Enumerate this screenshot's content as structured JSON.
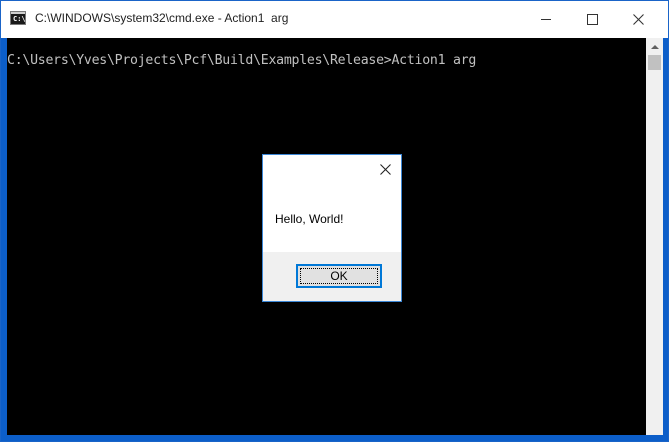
{
  "window": {
    "title": "C:\\WINDOWS\\system32\\cmd.exe - Action1  arg",
    "icon": "cmd-icon",
    "icon_text": "C:\\"
  },
  "console": {
    "prompt_line": "C:\\Users\\Yves\\Projects\\Pcf\\Build\\Examples\\Release>Action1 arg"
  },
  "dialog": {
    "message": "Hello, World!",
    "ok_label": "OK"
  }
}
